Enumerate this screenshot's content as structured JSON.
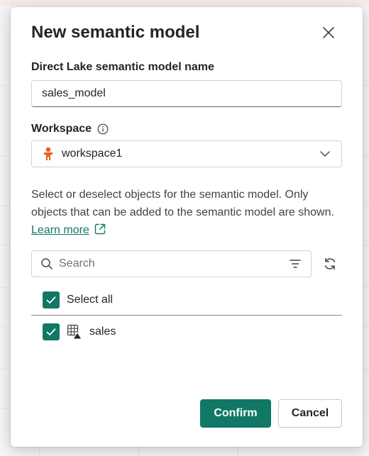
{
  "dialog": {
    "title": "New semantic model",
    "close_icon": "close-icon"
  },
  "model_name": {
    "label": "Direct Lake semantic model name",
    "value": "sales_model"
  },
  "workspace": {
    "label": "Workspace",
    "info_icon": "info-icon",
    "icon": "workspace-icon",
    "value": "workspace1",
    "chevron_icon": "chevron-down-icon"
  },
  "description": {
    "text": "Select or deselect objects for the semantic model. Only objects that can be added to the semantic model are shown.",
    "link_label": "Learn more",
    "link_icon": "external-link-icon"
  },
  "search": {
    "placeholder": "Search",
    "icon": "search-icon",
    "filter_icon": "filter-icon",
    "refresh_icon": "refresh-icon"
  },
  "objects": {
    "select_all_label": "Select all",
    "select_all_checked": true,
    "items": [
      {
        "label": "sales",
        "checked": true,
        "icon": "table-icon"
      }
    ]
  },
  "footer": {
    "confirm_label": "Confirm",
    "cancel_label": "Cancel"
  },
  "colors": {
    "accent": "#117865",
    "workspace_icon": "#e8601c"
  }
}
